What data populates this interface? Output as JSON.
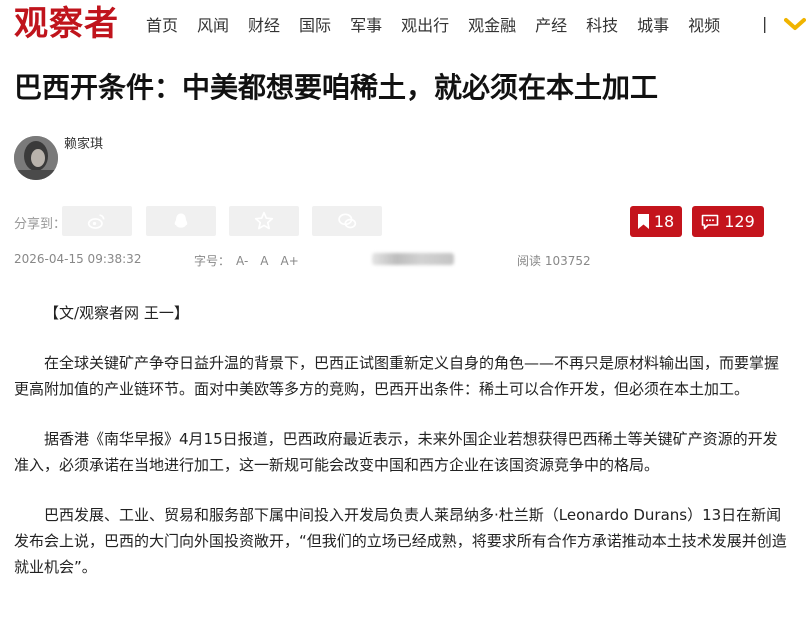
{
  "header": {
    "logo": "观察者",
    "nav": [
      "首页",
      "风闻",
      "财经",
      "国际",
      "军事",
      "观出行",
      "观金融",
      "产经",
      "科技",
      "城事",
      "视频"
    ],
    "separator": "|"
  },
  "article": {
    "title": "巴西开条件：中美都想要咱稀土，就必须在本土加工",
    "author": "赖家琪",
    "share_label": "分享到：",
    "share_icons": [
      "weibo-icon",
      "qq-icon",
      "qzone-star-icon",
      "wechat-icon"
    ],
    "bookmark_count": "18",
    "comment_count": "129",
    "date": "2026-04-15 09:38:32",
    "font_size_label": "字号：",
    "font_sizes": [
      "A-",
      "A",
      "A+"
    ],
    "read_label": "阅读",
    "read_count": "103752",
    "byline": "【文/观察者网 王一】",
    "paragraphs": [
      "在全球关键矿产争夺日益升温的背景下，巴西正试图重新定义自身的角色——不再只是原材料输出国，而要掌握更高附加值的产业链环节。面对中美欧等多方的竞购，巴西开出条件：稀土可以合作开发，但必须在本土加工。",
      "据香港《南华早报》4月15日报道，巴西政府最近表示，未来外国企业若想获得巴西稀土等关键矿产资源的开发准入，必须承诺在当地进行加工，这一新规可能会改变中国和西方企业在该国资源竞争中的格局。",
      "巴西发展、工业、贸易和服务部下属中间投入开发局负责人莱昂纳多·杜兰斯（Leonardo Durans）13日在新闻发布会上说，巴西的大门向外国投资敞开，“但我们的立场已经成熟，将要求所有合作方承诺推动本土技术发展并创造就业机会”。"
    ]
  },
  "colors": {
    "brand": "#c0141c",
    "badge": "#c4141c",
    "share_bg": "#f0f0f0",
    "meta_text": "#888888"
  }
}
